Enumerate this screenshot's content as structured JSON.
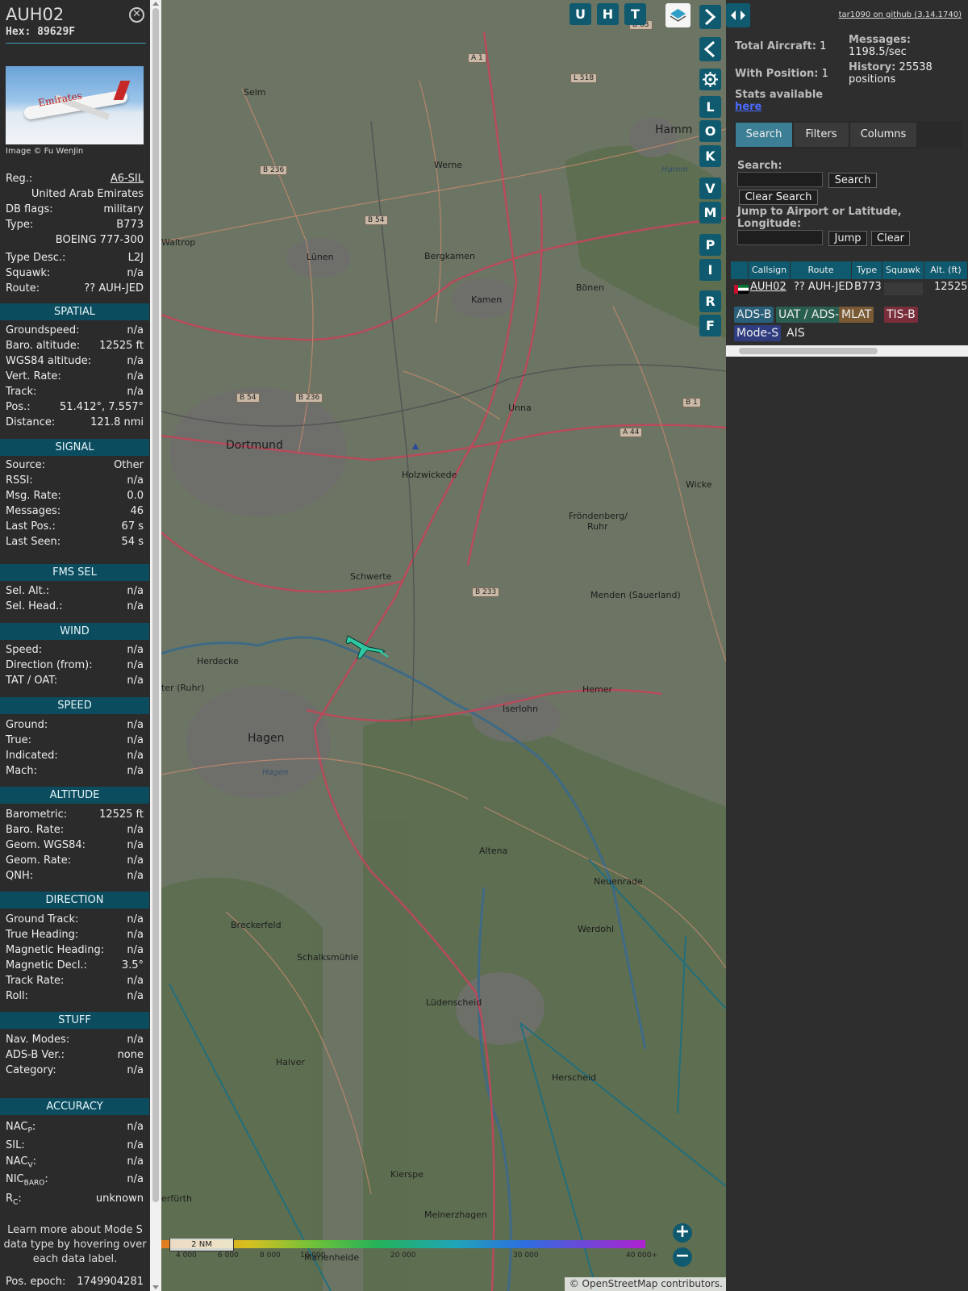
{
  "aircraft": {
    "callsign": "AUH02",
    "hex_label": "Hex:",
    "hex": "89629F",
    "photo_credit": "Image © Fu WenJin",
    "photo_livery": "Emirates"
  },
  "details": {
    "reg_label": "Reg.:",
    "reg": "A6-SIL",
    "country": "United Arab Emirates",
    "dbflags_label": "DB flags:",
    "dbflags": "military",
    "type_label": "Type:",
    "type": "B773",
    "type_full": "BOEING 777-300",
    "typedesc_label": "Type Desc.:",
    "typedesc": "L2J",
    "squawk_label": "Squawk:",
    "squawk": "n/a",
    "route_label": "Route:",
    "route": "?? AUH-JED"
  },
  "sections": {
    "spatial": "SPATIAL",
    "signal": "SIGNAL",
    "fms": "FMS SEL",
    "wind": "WIND",
    "speed": "SPEED",
    "altitude": "ALTITUDE",
    "direction": "DIRECTION",
    "stuff": "STUFF",
    "accuracy": "ACCURACY"
  },
  "spatial": [
    {
      "label": "Groundspeed:",
      "value": "n/a"
    },
    {
      "label": "Baro. altitude:",
      "value": "12525 ft"
    },
    {
      "label": "WGS84 altitude:",
      "value": "n/a"
    },
    {
      "label": "Vert. Rate:",
      "value": "n/a"
    },
    {
      "label": "Track:",
      "value": "n/a"
    },
    {
      "label": "Pos.:",
      "value": "51.412°, 7.557°"
    },
    {
      "label": "Distance:",
      "value": "121.8 nmi"
    }
  ],
  "signal": [
    {
      "label": "Source:",
      "value": "Other"
    },
    {
      "label": "RSSI:",
      "value": "n/a"
    },
    {
      "label": "Msg. Rate:",
      "value": "0.0"
    },
    {
      "label": "Messages:",
      "value": "46"
    },
    {
      "label": "Last Pos.:",
      "value": "67 s"
    },
    {
      "label": "Last Seen:",
      "value": "54 s"
    }
  ],
  "fms": [
    {
      "label": "Sel. Alt.:",
      "value": "n/a"
    },
    {
      "label": "Sel. Head.:",
      "value": "n/a"
    }
  ],
  "wind": [
    {
      "label": "Speed:",
      "value": "n/a"
    },
    {
      "label": "Direction (from):",
      "value": "n/a"
    },
    {
      "label": "TAT / OAT:",
      "value": "n/a"
    }
  ],
  "speed": [
    {
      "label": "Ground:",
      "value": "n/a"
    },
    {
      "label": "True:",
      "value": "n/a"
    },
    {
      "label": "Indicated:",
      "value": "n/a"
    },
    {
      "label": "Mach:",
      "value": "n/a"
    }
  ],
  "altitude": [
    {
      "label": "Barometric:",
      "value": "12525 ft"
    },
    {
      "label": "Baro. Rate:",
      "value": "n/a"
    },
    {
      "label": "Geom. WGS84:",
      "value": "n/a"
    },
    {
      "label": "Geom. Rate:",
      "value": "n/a"
    },
    {
      "label": "QNH:",
      "value": "n/a"
    }
  ],
  "direction": [
    {
      "label": "Ground Track:",
      "value": "n/a"
    },
    {
      "label": "True Heading:",
      "value": "n/a"
    },
    {
      "label": "Magnetic Heading:",
      "value": "n/a"
    },
    {
      "label": "Magnetic Decl.:",
      "value": "3.5°"
    },
    {
      "label": "Track Rate:",
      "value": "n/a"
    },
    {
      "label": "Roll:",
      "value": "n/a"
    }
  ],
  "stuff": [
    {
      "label": "Nav. Modes:",
      "value": "n/a"
    },
    {
      "label": "ADS-B Ver.:",
      "value": "none"
    },
    {
      "label": "Category:",
      "value": "n/a"
    }
  ],
  "accuracy": {
    "nacp_label": "NAC",
    "nacp_sub": "P",
    "nacp": "n/a",
    "sil_label": "SIL:",
    "sil": "n/a",
    "nacv_label": "NAC",
    "nacv_sub": "V",
    "nacv": "n/a",
    "nicbaro_label": "NIC",
    "nicbaro_sub": "BARO",
    "nicbaro": "n/a",
    "rc_label": "R",
    "rc_sub": "C",
    "rc": "unknown"
  },
  "learn_more": "Learn more about Mode S data type by hovering over each data label.",
  "pos_epoch_label": "Pos. epoch:",
  "pos_epoch": "1749904281",
  "map": {
    "buttons_top": [
      "U",
      "H",
      "T"
    ],
    "buttons_side": [
      "L",
      "O",
      "K",
      "V",
      "M",
      "P",
      "I",
      "R",
      "F"
    ],
    "places": {
      "dortmund": "Dortmund",
      "hagen": "Hagen",
      "hamm": "Hamm",
      "unna": "Unna",
      "schwerte": "Schwerte",
      "holzwickede": "Holzwickede",
      "kamen": "Kamen",
      "lunen": "Lünen",
      "bergkamen": "Bergkamen",
      "werne": "Werne",
      "selm": "Selm",
      "bonen": "Bönen",
      "herdecke": "Herdecke",
      "iserlohn": "Iserlohn",
      "hemer": "Hemer",
      "menden": "Menden (Sauerland)",
      "frondenberg": "Fröndenberg/",
      "ruhr": "Ruhr",
      "altena": "Altena",
      "neuenrade": "Neuenrade",
      "werdohl": "Werdohl",
      "breckerfeld": "Breckerfeld",
      "schalksmuhle": "Schalksmühle",
      "ludenscheid": "Lüdenscheid",
      "halver": "Halver",
      "herscheid": "Herscheid",
      "kierspe": "Kierspe",
      "meinerzhagen": "Meinerzhagen",
      "waltrop": "Waltrop",
      "wetter": "ter (Ruhr)",
      "wickede": "Wicke",
      "furth": "erfürth",
      "marienheide": "Marienheide",
      "hamm_river": "Hamm",
      "hagen_river": "Hagen"
    },
    "roads": [
      "A 1",
      "L 518",
      "B 236",
      "B 54",
      "B 54",
      "B 236",
      "B 1",
      "A 44",
      "B 233",
      "B 63"
    ],
    "altitude_scale": [
      "4 000",
      "6 000",
      "8 000",
      "10 000",
      "20 000",
      "30 000",
      "40 000+"
    ],
    "scale_label": "2 NM",
    "attribution": "© OpenStreetMap contributors.",
    "zoom_in": "+",
    "zoom_out": "−"
  },
  "right": {
    "github": "tar1090 on github (3.14.1740)",
    "total_aircraft_label": "Total Aircraft:",
    "total_aircraft": "1",
    "with_position_label": "With Position:",
    "with_position": "1",
    "messages_label": "Messages:",
    "messages": "1198.5/sec",
    "history_label": "History:",
    "history": "25538 positions",
    "stats_label": "Stats available",
    "stats_link": "here",
    "tabs": [
      "Search",
      "Filters",
      "Columns"
    ],
    "search_label": "Search:",
    "search_value": "",
    "search_button": "Search",
    "clear_search_button": "Clear Search",
    "jump_label": "Jump to Airport or Latitude, Longitude:",
    "jump_value": "",
    "jump_button": "Jump",
    "clear_button": "Clear",
    "table": {
      "headers": [
        "Callsign",
        "Route",
        "Type",
        "Squawk",
        "Alt. (ft)"
      ],
      "rows": [
        {
          "callsign": "AUH02",
          "route": "?? AUH-JED",
          "type": "B773",
          "squawk": "",
          "alt": "12525"
        }
      ]
    },
    "sources": [
      {
        "label": "ADS-B",
        "color": "#2a5f7a"
      },
      {
        "label": "UAT / ADS-R",
        "color": "#2a5e50"
      },
      {
        "label": "MLAT",
        "color": "#7a5a34"
      },
      {
        "label": "TIS-B",
        "color": "#7a2d3a"
      },
      {
        "label": "Mode-S",
        "color": "#2f3d80"
      },
      {
        "label": "AIS",
        "color": "#2e2e2e"
      }
    ]
  }
}
